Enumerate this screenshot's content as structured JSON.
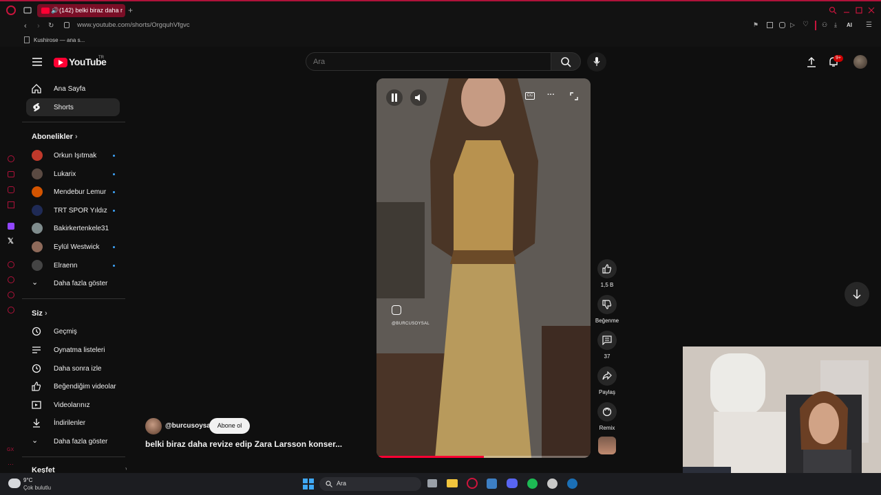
{
  "browser": {
    "tab_title": "(142) belki biraz daha r",
    "url": "www.youtube.com/shorts/OrgquhVfgvc",
    "bookmark": "Kushirose — ana s...",
    "toolbar_ai": "AI"
  },
  "youtube": {
    "logo": "YouTube",
    "region": "TR",
    "search_placeholder": "Ara",
    "notif_count": "9+",
    "nav": [
      {
        "label": "Ana Sayfa"
      },
      {
        "label": "Shorts"
      }
    ],
    "subs_title": "Abonelikler",
    "subs": [
      {
        "name": "Orkun Işıtmak",
        "color": "#c0392b"
      },
      {
        "name": "Lukarix",
        "color": "#5a4a42"
      },
      {
        "name": "Mendebur Lemur",
        "color": "#d35400"
      },
      {
        "name": "TRT SPOR Yıldız",
        "color": "#1f2a55"
      },
      {
        "name": "Bakirkertenkele31",
        "color": "#7f8c8d"
      },
      {
        "name": "Eylül Westwick",
        "color": "#8e6a5a"
      },
      {
        "name": "Elraenn",
        "color": "#444"
      }
    ],
    "show_more": "Daha fazla göster",
    "you_title": "Siz",
    "you_items": [
      {
        "label": "Geçmiş",
        "icon": "history-icon"
      },
      {
        "label": "Oynatma listeleri",
        "icon": "playlist-icon"
      },
      {
        "label": "Daha sonra izle",
        "icon": "clock-icon"
      },
      {
        "label": "Beğendiğim videolar",
        "icon": "thumbs-up-icon"
      },
      {
        "label": "Videolarınız",
        "icon": "video-icon"
      },
      {
        "label": "İndirilenler",
        "icon": "download-icon"
      }
    ],
    "show_more2": "Daha fazla göster",
    "explore": "Keşfet"
  },
  "short": {
    "channel": "@burcusoysal",
    "subscribe": "Abone ol",
    "title": "belki biraz daha revize edip Zara Larsson konser...",
    "watermark": "@BURCUSOYSAL",
    "likes": "1,5 B",
    "dislike": "Beğenme",
    "comments": "37",
    "share": "Paylaş",
    "remix": "Remix",
    "progress": 0.5
  },
  "taskbar": {
    "temp": "9°C",
    "weather": "Çok bulutlu",
    "search": "Ara"
  },
  "colors": {
    "accent": "#ff0033",
    "opera": "#b0123a",
    "blue": "#3ea6ff"
  }
}
